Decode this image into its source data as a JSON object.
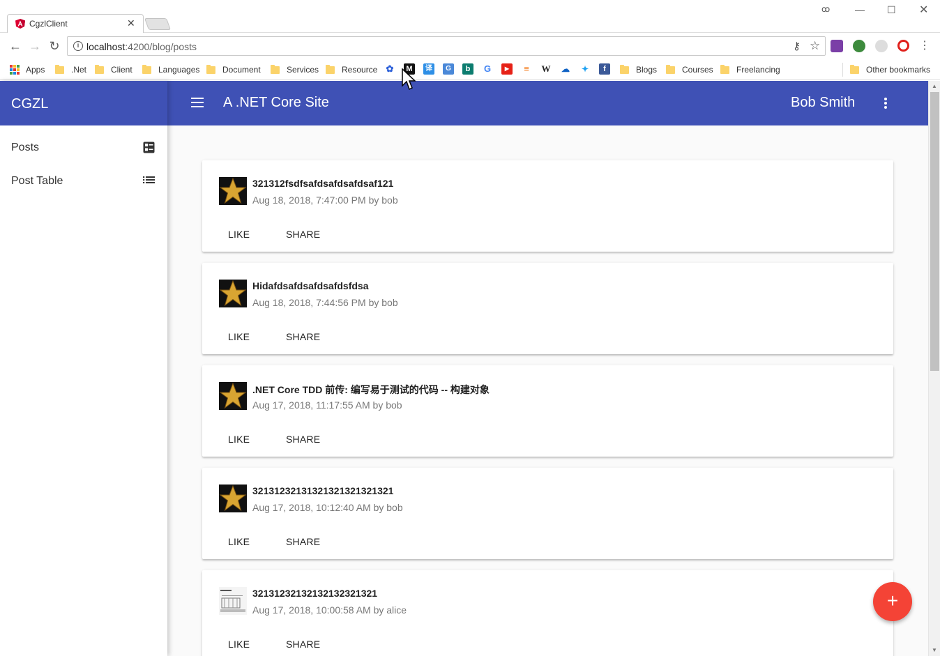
{
  "browser": {
    "tab_title": "CgzlClient",
    "url_host": "localhost",
    "url_path": ":4200/blog/posts",
    "bookmarks": {
      "apps": "Apps",
      "folders": [
        ".Net",
        "Client",
        "Languages",
        "Document",
        "Services",
        "Resource"
      ],
      "folders2": [
        "Blogs",
        "Courses",
        "Freelancing"
      ],
      "other": "Other bookmarks"
    }
  },
  "app": {
    "brand": "CGZL",
    "site_title": "A .NET Core Site",
    "user_name": "Bob Smith",
    "sidenav": [
      {
        "label": "Posts",
        "icon": "dashboard-list-icon"
      },
      {
        "label": "Post Table",
        "icon": "list-icon"
      }
    ],
    "like_label": "LIKE",
    "share_label": "SHARE",
    "fab_label": "+",
    "posts": [
      {
        "title": "321312fsdfsafdsafdsafdsaf121",
        "meta": "Aug 18, 2018, 7:47:00 PM by bob",
        "thumb": "star"
      },
      {
        "title": "Hidafdsafdsafdsafdsfdsa",
        "meta": "Aug 18, 2018, 7:44:56 PM by bob",
        "thumb": "star"
      },
      {
        "title": ".NET Core TDD 前传: 编写易于测试的代码 -- 构建对象",
        "meta": "Aug 17, 2018, 11:17:55 AM by bob",
        "thumb": "star"
      },
      {
        "title": "321312321313213213213213​21",
        "meta": "Aug 17, 2018, 10:12:40 AM by bob",
        "thumb": "star"
      },
      {
        "title": "32131232132132132321321",
        "meta": "Aug 17, 2018, 10:00:58 AM by alice",
        "thumb": "sketch"
      }
    ]
  },
  "colors": {
    "primary": "#3f51b5",
    "accent": "#f44336"
  }
}
